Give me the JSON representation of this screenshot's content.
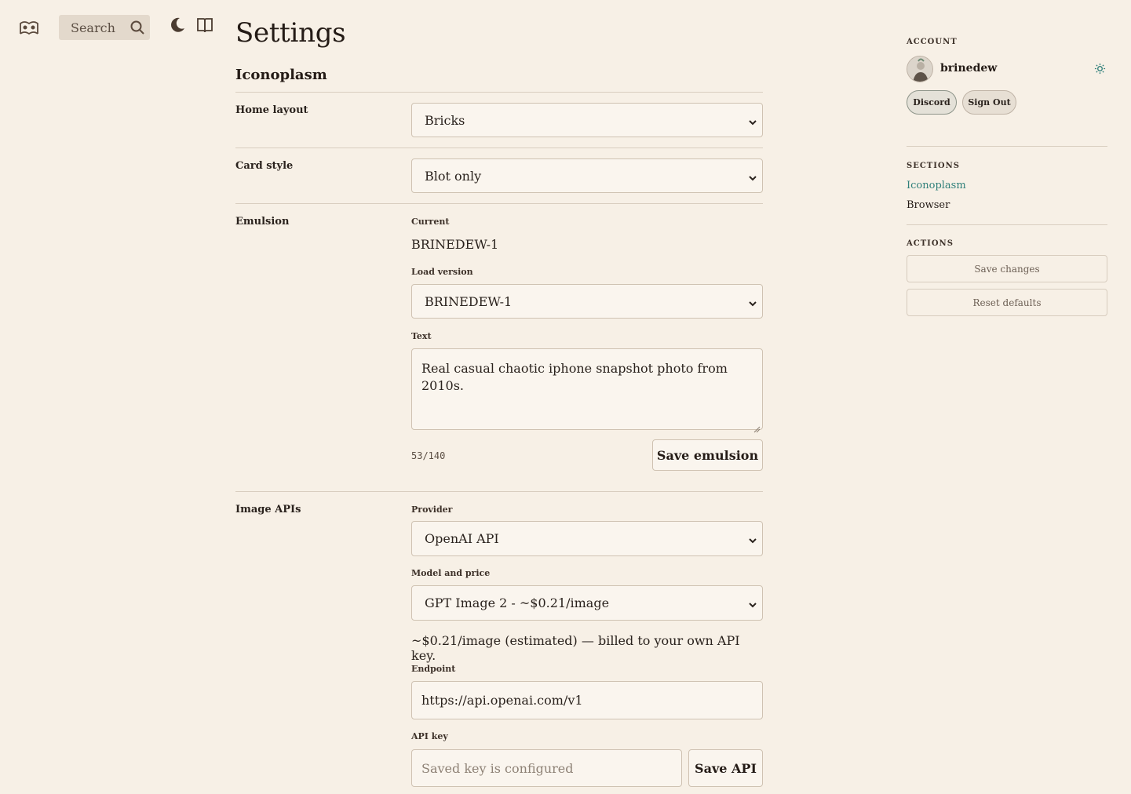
{
  "nav": {
    "search_label": "Search",
    "icons": [
      "logo-icon",
      "search-icon",
      "moon-icon",
      "book-icon"
    ]
  },
  "page": {
    "title": "Settings",
    "section": "Iconoplasm"
  },
  "settings": {
    "home_layout": {
      "label": "Home layout",
      "value": "Bricks"
    },
    "card_style": {
      "label": "Card style",
      "value": "Blot only"
    },
    "emulsion": {
      "label": "Emulsion",
      "current_label": "Current",
      "current_value": "BRINEDEW-1",
      "load_version_label": "Load version",
      "load_version_value": "BRINEDEW-1",
      "text_label": "Text",
      "text_value": "Real casual chaotic iphone snapshot photo from 2010s.",
      "counter": "53/140",
      "save_label": "Save emulsion"
    },
    "image_apis": {
      "label": "Image APIs",
      "provider_label": "Provider",
      "provider_value": "OpenAI API",
      "model_label": "Model and price",
      "model_value": "GPT Image 2 - ~$0.21/image",
      "price_note": "~$0.21/image (estimated) — billed to your own API key.",
      "endpoint_label": "Endpoint",
      "endpoint_value": "https://api.openai.com/v1",
      "api_key_label": "API key",
      "api_key_placeholder": "Saved key is configured",
      "save_label": "Save API"
    }
  },
  "sidebar": {
    "account_heading": "ACCOUNT",
    "username": "brinedew",
    "discord_label": "Discord",
    "signout_label": "Sign Out",
    "sections_heading": "SECTIONS",
    "sections": [
      "Iconoplasm",
      "Browser"
    ],
    "actions_heading": "ACTIONS",
    "save_changes_label": "Save changes",
    "reset_defaults_label": "Reset defaults"
  },
  "colors": {
    "background": "#f7f0e6",
    "accent": "#2f7f79",
    "text": "#2a221d"
  }
}
